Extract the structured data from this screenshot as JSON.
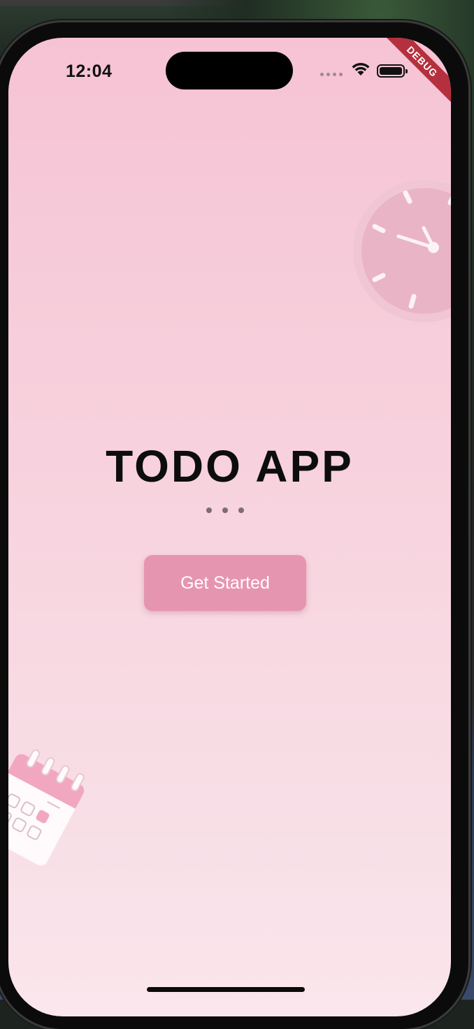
{
  "status_bar": {
    "time": "12:04",
    "icons": [
      "cellular-signal-icon",
      "wifi-icon",
      "battery-icon"
    ]
  },
  "debug_banner": {
    "label": "DEBUG",
    "color": "#b5303e"
  },
  "splash": {
    "title": "TODO APP",
    "button_label": "Get Started",
    "decorations": [
      "clock-illustration",
      "calendar-illustration"
    ],
    "indicator_dots": 3
  },
  "colors": {
    "background_top": "#f6c3d4",
    "background_bottom": "#fae6ec",
    "button": "#e695b1",
    "title": "#0d0d0d"
  }
}
